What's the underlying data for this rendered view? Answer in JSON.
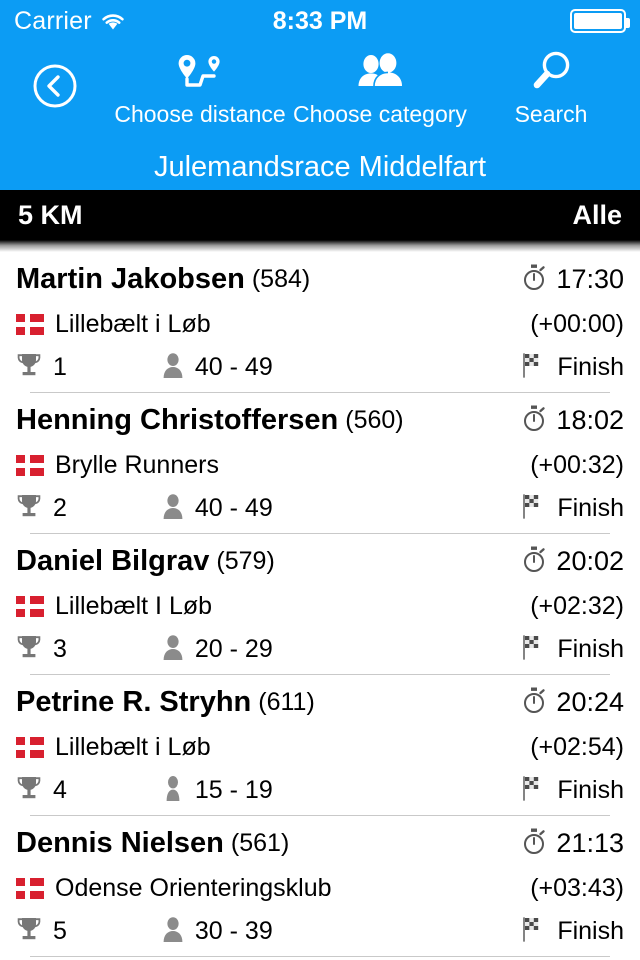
{
  "status_bar": {
    "carrier": "Carrier",
    "time": "8:33 PM",
    "wifi_icon": "wifi-icon",
    "battery_icon": "battery-full-icon"
  },
  "navbar": {
    "back_icon": "back-circle-icon",
    "buttons": [
      {
        "icon": "route-pins-icon",
        "label": "Choose distance"
      },
      {
        "icon": "people-icon",
        "label": "Choose category"
      },
      {
        "icon": "search-icon",
        "label": "Search"
      }
    ],
    "race_title": "Julemandsrace Middelfart",
    "background_color": "#0c9cf4"
  },
  "section_bar": {
    "distance": "5 KM",
    "category": "Alle",
    "background_color": "#000000"
  },
  "results": [
    {
      "name": "Martin Jakobsen",
      "bib": "(584)",
      "time": "17:30",
      "club": "Lillebælt i Løb",
      "gap": "(+00:00)",
      "place": "1",
      "age_group": "40 - 49",
      "status": "Finish",
      "flag_icon": "denmark-flag-icon",
      "timer_icon": "stopwatch-icon",
      "trophy_icon": "trophy-icon",
      "person_icon": "person-male-icon",
      "finish_icon": "checkered-flag-icon"
    },
    {
      "name": "Henning Christoffersen",
      "bib": "(560)",
      "time": "18:02",
      "club": "Brylle Runners",
      "gap": "(+00:32)",
      "place": "2",
      "age_group": "40 - 49",
      "status": "Finish",
      "flag_icon": "denmark-flag-icon",
      "timer_icon": "stopwatch-icon",
      "trophy_icon": "trophy-icon",
      "person_icon": "person-male-icon",
      "finish_icon": "checkered-flag-icon"
    },
    {
      "name": "Daniel Bilgrav",
      "bib": "(579)",
      "time": "20:02",
      "club": "Lillebælt I Løb",
      "gap": "(+02:32)",
      "place": "3",
      "age_group": "20 - 29",
      "status": "Finish",
      "flag_icon": "denmark-flag-icon",
      "timer_icon": "stopwatch-icon",
      "trophy_icon": "trophy-icon",
      "person_icon": "person-male-icon",
      "finish_icon": "checkered-flag-icon"
    },
    {
      "name": "Petrine R. Stryhn",
      "bib": "(611)",
      "time": "20:24",
      "club": "Lillebælt i Løb",
      "gap": "(+02:54)",
      "place": "4",
      "age_group": "15 - 19",
      "status": "Finish",
      "flag_icon": "denmark-flag-icon",
      "timer_icon": "stopwatch-icon",
      "trophy_icon": "trophy-icon",
      "person_icon": "person-female-icon",
      "finish_icon": "checkered-flag-icon"
    },
    {
      "name": "Dennis Nielsen",
      "bib": "(561)",
      "time": "21:13",
      "club": "Odense Orienteringsklub",
      "gap": "(+03:43)",
      "place": "5",
      "age_group": "30 - 39",
      "status": "Finish",
      "flag_icon": "denmark-flag-icon",
      "timer_icon": "stopwatch-icon",
      "trophy_icon": "trophy-icon",
      "person_icon": "person-male-icon",
      "finish_icon": "checkered-flag-icon"
    }
  ]
}
